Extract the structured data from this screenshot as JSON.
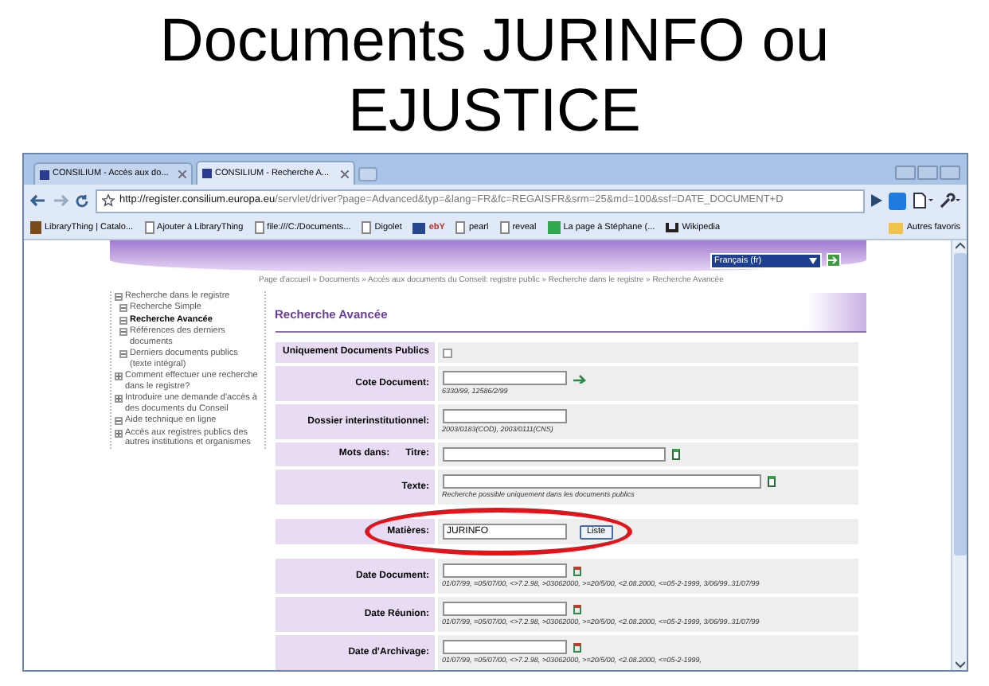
{
  "slide_title": [
    "Documents JURINFO ou",
    "EJUSTICE"
  ],
  "browser": {
    "tabs": [
      {
        "label": "CONSILIUM - Accès aux do...",
        "selected": false
      },
      {
        "label": "CONSILIUM - Recherche A...",
        "selected": true
      }
    ],
    "url_host": "http://register.consilium.europa.eu",
    "url_path": "/servlet/driver?page=Advanced&typ=&lang=FR&fc=REGAISFR&srm=25&md=100&ssf=DATE_DOCUMENT+D",
    "bookmarks": [
      {
        "label": "LibraryThing | Catalo...",
        "kind": "logo"
      },
      {
        "label": "Ajouter à LibraryThing",
        "kind": "page"
      },
      {
        "label": "file:///C:/Documents...",
        "kind": "page"
      },
      {
        "label": "Digolet",
        "kind": "page"
      },
      {
        "label": "ebY",
        "kind": "badge"
      },
      {
        "label": "pearl",
        "kind": "page"
      },
      {
        "label": "reveal",
        "kind": "page"
      },
      {
        "label": "La page à Stéphane (...",
        "kind": "plus"
      },
      {
        "label": "Wikipedia",
        "kind": "wiki"
      }
    ],
    "other_bookmarks": "Autres favoris"
  },
  "language": "Français (fr)",
  "breadcrumb": "Page d'accueil » Documents » Accès aux documents du Conseil: registre public » Recherche dans le registre » Recherche Avancée",
  "sidebar": [
    {
      "label": "Recherche dans le registre",
      "expanded": true,
      "selected": false,
      "children": [
        {
          "label": "Recherche Simple",
          "expanded": true,
          "selected": false
        },
        {
          "label": "Recherche Avancée",
          "expanded": true,
          "selected": true
        },
        {
          "label": "Références des derniers documents",
          "expanded": true,
          "selected": false
        },
        {
          "label": "Derniers documents publics (texte intégral)",
          "expanded": true,
          "selected": false
        }
      ]
    },
    {
      "label": "Comment effectuer une recherche dans le registre?",
      "expanded": false,
      "selected": false
    },
    {
      "label": "Introduire une demande d'accès à des documents du Conseil",
      "expanded": false,
      "selected": false
    },
    {
      "label": "Aide technique en ligne",
      "expanded": true,
      "selected": false
    },
    {
      "label": "Accès aux registres publics des autres institutions et organismes",
      "expanded": false,
      "selected": false
    }
  ],
  "form": {
    "title": "Recherche Avancée",
    "fields": [
      {
        "kind": "checkbox",
        "label": "Uniquement Documents Publics",
        "checked": false
      },
      {
        "kind": "code",
        "label": "Cote Document:",
        "hint": "6330/99, 12586/2/99"
      },
      {
        "kind": "plain",
        "label": "Dossier interinstitutionnel:",
        "hint": "2003/0183(COD), 2003/0111(CNS)"
      },
      {
        "kind": "words",
        "label": "Mots dans:",
        "sublabel": "Titre:"
      },
      {
        "kind": "words",
        "label": "Texte:",
        "hint": "Recherche possible uniquement dans les documents publics"
      },
      {
        "kind": "list",
        "label": "Matières:",
        "value": "JURINFO",
        "button": "Liste"
      },
      {
        "kind": "date",
        "label": "Date Document:",
        "hint": "01/07/99, =05/07/00, <>7.2.98, >03062000, >=20/5/00, <2.08.2000, <=05-2-1999, 3/06/99..31/07/99"
      },
      {
        "kind": "date",
        "label": "Date Réunion:",
        "hint": "01/07/99, =05/07/00, <>7.2.98, >03062000, >=20/5/00, <2.08.2000, <=05-2-1999, 3/06/99..31/07/99"
      },
      {
        "kind": "date",
        "label": "Date d'Archivage:",
        "hint": "01/07/99, =05/07/00, <>7.2.98, >03062000, >=20/5/00, <2.08.2000, <=05-2-1999,"
      }
    ]
  }
}
